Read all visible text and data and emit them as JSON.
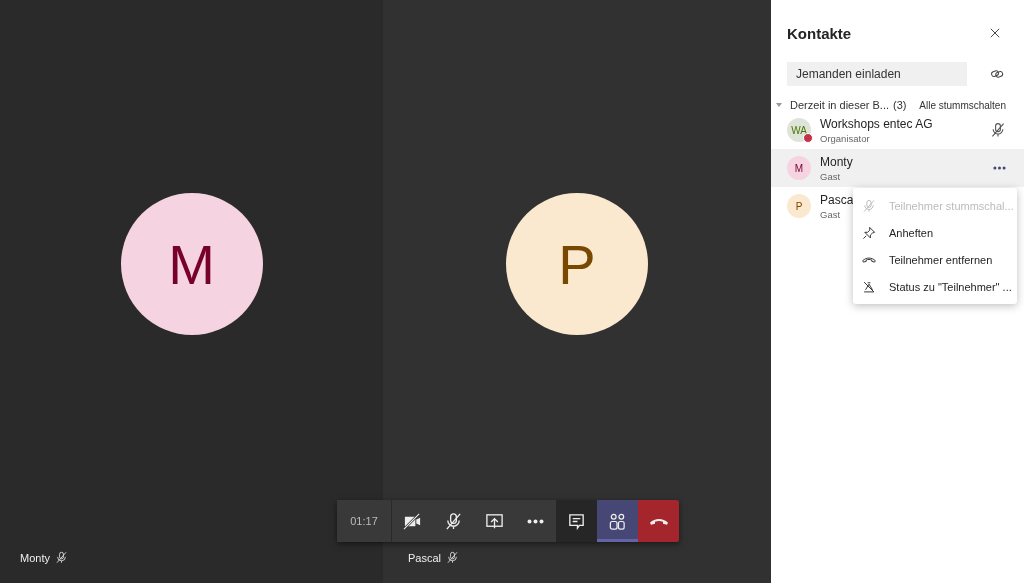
{
  "tiles": [
    {
      "initial": "M",
      "name": "Monty",
      "muted": true,
      "color": "#f6d3e0"
    },
    {
      "initial": "P",
      "name": "Pascal",
      "muted": true,
      "color": "#fbe9cf"
    }
  ],
  "call_bar": {
    "timer": "01:17",
    "controls": [
      {
        "kind": "camera-off",
        "selected": false
      },
      {
        "kind": "mic-off",
        "selected": false
      },
      {
        "kind": "share",
        "selected": false
      },
      {
        "kind": "more",
        "selected": false
      },
      {
        "kind": "chat",
        "selected": false
      },
      {
        "kind": "people",
        "selected": true
      },
      {
        "kind": "hangup",
        "selected": false
      }
    ]
  },
  "panel": {
    "title": "Kontakte",
    "invite": {
      "placeholder": "Jemanden einladen"
    },
    "section": {
      "label": "Derzeit in dieser B...",
      "count": "(3)",
      "expanded": true,
      "action": "Alle stummschalten"
    },
    "participants": [
      {
        "initials": "WA",
        "name": "Workshops entec AG",
        "role": "Organisator",
        "color": "#dfe3d9",
        "status_dot": true,
        "muted": true,
        "hovered": false
      },
      {
        "initials": "M",
        "name": "Monty",
        "role": "Gast",
        "color": "#f6d3e0",
        "status_dot": false,
        "muted": false,
        "hovered": true
      },
      {
        "initials": "P",
        "name": "Pasca",
        "role": "Gast",
        "color": "#fbe9cf",
        "status_dot": false,
        "muted": false,
        "hovered": false
      }
    ],
    "menu": [
      {
        "kind": "mute",
        "label": "Teilnehmer stummschal...",
        "disabled": true
      },
      {
        "kind": "pin",
        "label": "Anheften",
        "disabled": false
      },
      {
        "kind": "remove",
        "label": "Teilnehmer entfernen",
        "disabled": false
      },
      {
        "kind": "status",
        "label": "Status zu \"Teilnehmer\" ...",
        "disabled": false
      }
    ]
  }
}
